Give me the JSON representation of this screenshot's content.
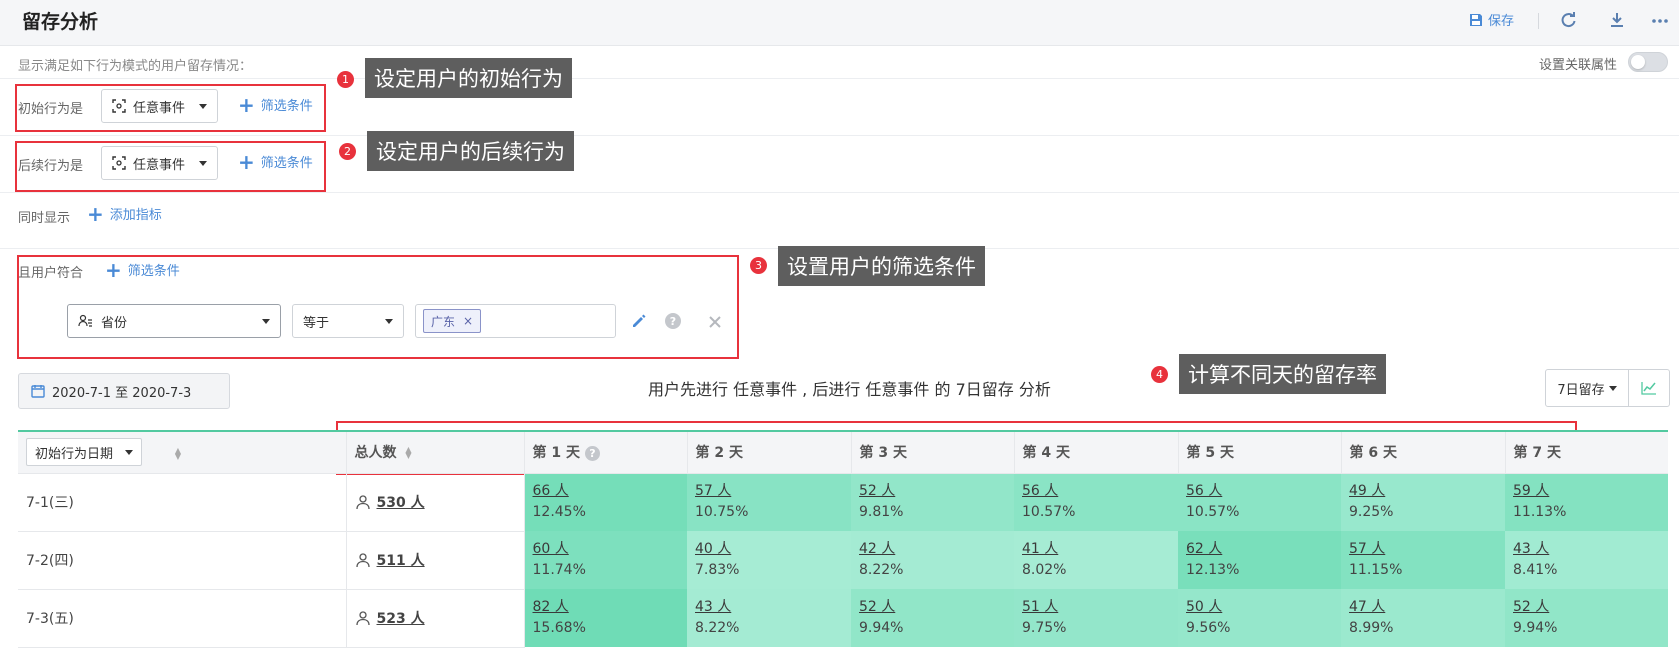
{
  "header": {
    "title": "留存分析",
    "save_label": "保存"
  },
  "description": "显示满足如下行为模式的用户留存情况：",
  "link_attr_label": "设置关联属性",
  "initial_behavior": {
    "label": "初始行为是",
    "event": "任意事件",
    "filter_label": "筛选条件"
  },
  "follow_behavior": {
    "label": "后续行为是",
    "event": "任意事件",
    "filter_label": "筛选条件"
  },
  "also_show": {
    "label": "同时显示",
    "add_label": "添加指标"
  },
  "user_filter": {
    "label": "且用户符合",
    "filter_label": "筛选条件",
    "field": "省份",
    "operator": "等于",
    "value_tag": "广东",
    "tag_remove": "×"
  },
  "callouts": [
    {
      "num": "1",
      "text": "设定用户的初始行为"
    },
    {
      "num": "2",
      "text": "设定用户的后续行为"
    },
    {
      "num": "3",
      "text": "设置用户的筛选条件"
    },
    {
      "num": "4",
      "text": "计算不同天的留存率"
    }
  ],
  "date_range": "2020-7-1 至 2020-7-3",
  "summary": "用户先进行 任意事件 , 后进行 任意事件 的 7日留存 分析",
  "retention_select": "7日留存",
  "table": {
    "date_col_select": "初始行为日期",
    "total_header": "总人数",
    "day_headers": [
      "第 1 天",
      "第 2 天",
      "第 3 天",
      "第 4 天",
      "第 5 天",
      "第 6 天",
      "第 7 天"
    ],
    "rows": [
      {
        "date": "7-1(三)",
        "total": "530 人",
        "cells": [
          {
            "count": "66 人",
            "rate": "12.45%",
            "level": 0.1245
          },
          {
            "count": "57 人",
            "rate": "10.75%",
            "level": 0.1075
          },
          {
            "count": "52 人",
            "rate": "9.81%",
            "level": 0.0981
          },
          {
            "count": "56 人",
            "rate": "10.57%",
            "level": 0.1057
          },
          {
            "count": "56 人",
            "rate": "10.57%",
            "level": 0.1057
          },
          {
            "count": "49 人",
            "rate": "9.25%",
            "level": 0.0925
          },
          {
            "count": "59 人",
            "rate": "11.13%",
            "level": 0.1113
          }
        ]
      },
      {
        "date": "7-2(四)",
        "total": "511 人",
        "cells": [
          {
            "count": "60 人",
            "rate": "11.74%",
            "level": 0.1174
          },
          {
            "count": "40 人",
            "rate": "7.83%",
            "level": 0.0783
          },
          {
            "count": "42 人",
            "rate": "8.22%",
            "level": 0.0822
          },
          {
            "count": "41 人",
            "rate": "8.02%",
            "level": 0.0802
          },
          {
            "count": "62 人",
            "rate": "12.13%",
            "level": 0.1213
          },
          {
            "count": "57 人",
            "rate": "11.15%",
            "level": 0.1115
          },
          {
            "count": "43 人",
            "rate": "8.41%",
            "level": 0.0841
          }
        ]
      },
      {
        "date": "7-3(五)",
        "total": "523 人",
        "cells": [
          {
            "count": "82 人",
            "rate": "15.68%",
            "level": 0.1568
          },
          {
            "count": "43 人",
            "rate": "8.22%",
            "level": 0.0822
          },
          {
            "count": "52 人",
            "rate": "9.94%",
            "level": 0.0994
          },
          {
            "count": "51 人",
            "rate": "9.75%",
            "level": 0.0975
          },
          {
            "count": "50 人",
            "rate": "9.56%",
            "level": 0.0956
          },
          {
            "count": "47 人",
            "rate": "8.99%",
            "level": 0.0899
          },
          {
            "count": "52 人",
            "rate": "9.94%",
            "level": 0.0994
          }
        ]
      }
    ]
  },
  "colors": {
    "accent": "#4a8ad6",
    "highlight": "#e8323c",
    "cell_low": "#a6ecd4",
    "cell_high": "#6fdcb6"
  }
}
